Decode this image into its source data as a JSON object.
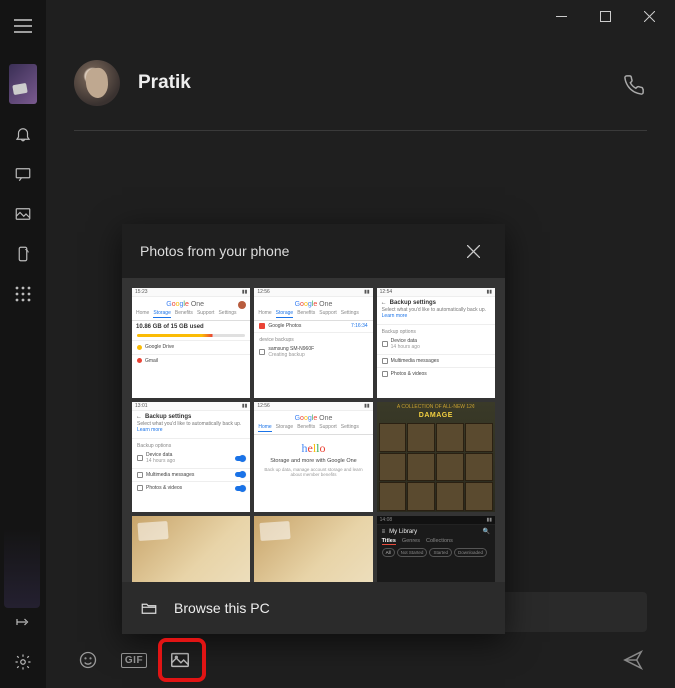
{
  "contact": {
    "name": "Pratik"
  },
  "popup": {
    "title": "Photos from your phone",
    "browse_label": "Browse this PC"
  },
  "composer": {
    "gif_label": "GIF"
  },
  "thumbs": {
    "google_one": "Google One",
    "tabs": {
      "home": "Home",
      "storage": "Storage",
      "benefits": "Benefits",
      "support": "Support",
      "settings": "Settings"
    },
    "storage_text": "10.86 GB of 15 GB used",
    "drive": "Google Drive",
    "gmail": "Gmail",
    "backup_settings": "Backup settings",
    "backup_desc": "Select what you'd like to automatically back up.",
    "learn_more": "Learn more",
    "google_photos": "Google Photos",
    "samsung": "samsung SM-N960F",
    "creating": "Creating backup",
    "backup_options": "Backup options",
    "device_data": "Device data",
    "mm_msgs": "Multimedia messages",
    "photos_videos": "Photos & videos",
    "hours_ago": "14 hours ago",
    "hello": "hello",
    "hello_sub": "Storage and more with Google One",
    "damage": "DAMAGE",
    "library": "My Library",
    "titles": "Titles",
    "genres": "Genres",
    "collections": "Collections",
    "all": "All",
    "not_started": "Not Started",
    "started": "Started",
    "downloaded": "Downloaded",
    "time1": "15:23",
    "time2": "12:56",
    "time3": "12:54",
    "time4": "13:01"
  }
}
